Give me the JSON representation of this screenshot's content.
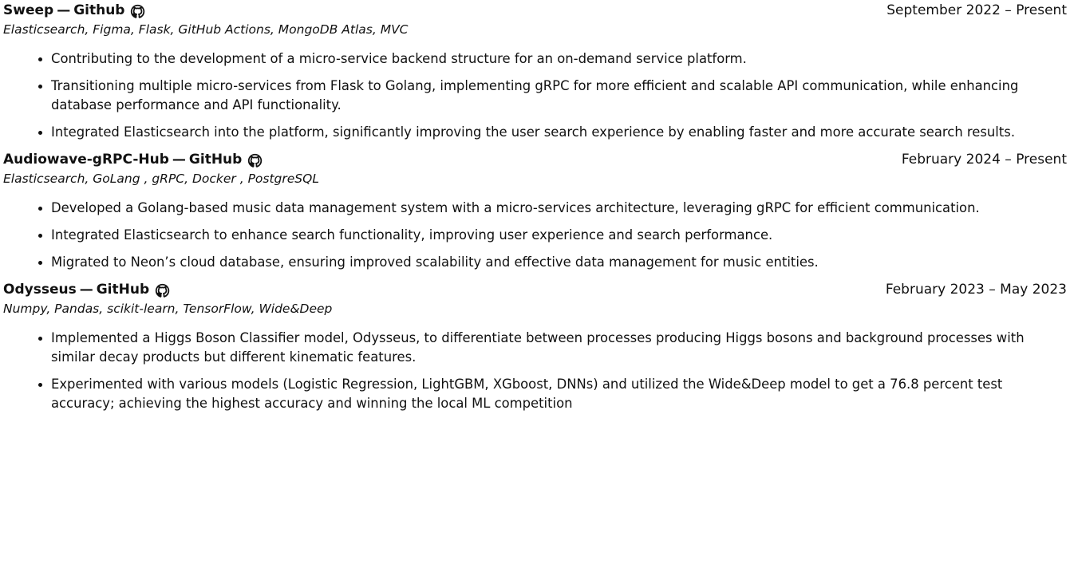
{
  "projects": [
    {
      "name": "Sweep",
      "separator": "—",
      "link_label": "Github",
      "date": "September 2022 – Present",
      "tech": "Elasticsearch, Figma, Flask, GitHub Actions, MongoDB Atlas, MVC",
      "bullets": [
        "Contributing to the development of a micro-service backend structure for an on-demand service platform.",
        "Transitioning multiple micro-services from Flask to Golang, implementing gRPC for more efficient and scalable API communication, while enhancing database performance and API functionality.",
        "Integrated Elasticsearch into the platform, significantly improving the user search experience by enabling faster and more accurate search results."
      ]
    },
    {
      "name": "Audiowave-gRPC-Hub",
      "separator": "—",
      "link_label": "GitHub",
      "date": "February 2024 – Present",
      "tech": "Elasticsearch, GoLang , gRPC, Docker , PostgreSQL",
      "bullets": [
        "Developed a Golang-based music data management system with a micro-services architecture, leveraging gRPC for efficient communication.",
        "Integrated Elasticsearch to enhance search functionality, improving user experience and search performance.",
        "Migrated to Neon’s cloud database, ensuring improved scalability and effective data management for music entities."
      ]
    },
    {
      "name": "Odysseus",
      "separator": "—",
      "link_label": "GitHub",
      "date": "February 2023 – May 2023",
      "tech": "Numpy, Pandas, scikit-learn, TensorFlow, Wide&Deep",
      "bullets": [
        "Implemented a Higgs Boson Classifier model, Odysseus, to differentiate between processes producing Higgs bosons and background processes with similar decay products but different kinematic features.",
        "Experimented with various models (Logistic Regression, LightGBM, XGboost, DNNs) and utilized the Wide&Deep model to get a 76.8 percent test accuracy; achieving the highest accuracy and winning the local ML competition"
      ]
    }
  ],
  "icons": {
    "link_icon": "github-icon"
  },
  "colors": {
    "text": "#111111",
    "background": "#ffffff"
  }
}
